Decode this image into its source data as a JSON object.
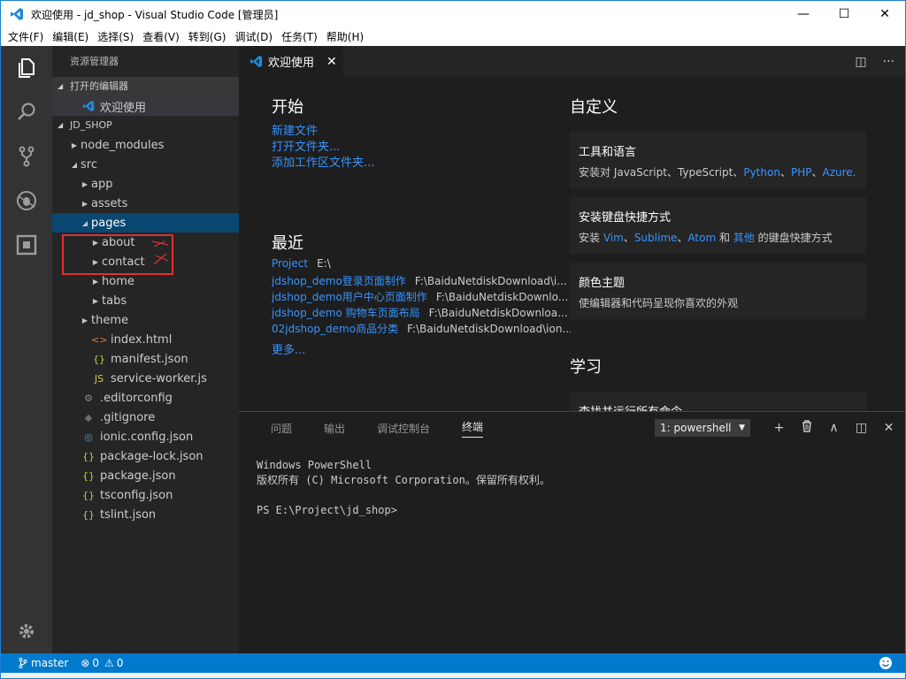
{
  "window": {
    "title": "欢迎使用 - jd_shop - Visual Studio Code [管理员]",
    "controls": {
      "minimize": "—",
      "maximize": "☐",
      "close": "✕"
    }
  },
  "menu": [
    "文件(F)",
    "编辑(E)",
    "选择(S)",
    "查看(V)",
    "转到(G)",
    "调试(D)",
    "任务(T)",
    "帮助(H)"
  ],
  "activity": [
    "explorer-icon",
    "search-icon",
    "source-control-icon",
    "debug-icon",
    "extensions-icon",
    "gear-icon"
  ],
  "sidebar": {
    "title": "资源管理器",
    "open_editors_header": "打开的编辑器",
    "open_editor": "欢迎使用",
    "project_header": "JD_SHOP",
    "tree": [
      {
        "label": "node_modules",
        "indent": 1,
        "twisty": "▶",
        "icon": ""
      },
      {
        "label": "src",
        "indent": 1,
        "twisty": "◢",
        "icon": ""
      },
      {
        "label": "app",
        "indent": 2,
        "twisty": "▶",
        "icon": ""
      },
      {
        "label": "assets",
        "indent": 2,
        "twisty": "▶",
        "icon": ""
      },
      {
        "label": "pages",
        "indent": 2,
        "twisty": "◢",
        "icon": "",
        "selected": true
      },
      {
        "label": "about",
        "indent": 3,
        "twisty": "▶",
        "icon": ""
      },
      {
        "label": "contact",
        "indent": 3,
        "twisty": "▶",
        "icon": ""
      },
      {
        "label": "home",
        "indent": 3,
        "twisty": "▶",
        "icon": ""
      },
      {
        "label": "tabs",
        "indent": 3,
        "twisty": "▶",
        "icon": ""
      },
      {
        "label": "theme",
        "indent": 2,
        "twisty": "▶",
        "icon": ""
      },
      {
        "label": "index.html",
        "indent": 2,
        "twisty": "",
        "icon": "<>",
        "iconColor": "#e37933"
      },
      {
        "label": "manifest.json",
        "indent": 2,
        "twisty": "",
        "icon": "{}",
        "iconColor": "#cbcb41"
      },
      {
        "label": "service-worker.js",
        "indent": 2,
        "twisty": "",
        "icon": "JS",
        "iconColor": "#cbcb41"
      },
      {
        "label": ".editorconfig",
        "indent": 1,
        "twisty": "",
        "icon": "⚙",
        "iconColor": "#8a8a8a"
      },
      {
        "label": ".gitignore",
        "indent": 1,
        "twisty": "",
        "icon": "◆",
        "iconColor": "#6d6d6d"
      },
      {
        "label": "ionic.config.json",
        "indent": 1,
        "twisty": "",
        "icon": "◎",
        "iconColor": "#519aba"
      },
      {
        "label": "package-lock.json",
        "indent": 1,
        "twisty": "",
        "icon": "{}",
        "iconColor": "#cbcb41"
      },
      {
        "label": "package.json",
        "indent": 1,
        "twisty": "",
        "icon": "{}",
        "iconColor": "#cbcb41"
      },
      {
        "label": "tsconfig.json",
        "indent": 1,
        "twisty": "",
        "icon": "{}",
        "iconColor": "#cbcb41"
      },
      {
        "label": "tslint.json",
        "indent": 1,
        "twisty": "",
        "icon": "{}",
        "iconColor": "#cbcb41"
      }
    ]
  },
  "editor": {
    "tab_label": "欢迎使用",
    "tab_close": "✕",
    "actions": [
      "◫",
      "···"
    ]
  },
  "welcome": {
    "start_heading": "开始",
    "start_links": [
      "新建文件",
      "打开文件夹...",
      "添加工作区文件夹..."
    ],
    "recent_heading": "最近",
    "recent": [
      {
        "name": "Project",
        "path": "E:\\"
      },
      {
        "name": "jdshop_demo登录页面制作",
        "path": "F:\\BaiduNetdiskDownload\\i..."
      },
      {
        "name": "jdshop_demo用户中心页面制作",
        "path": "F:\\BaiduNetdiskDownlo..."
      },
      {
        "name": "jdshop_demo 购物车页面布局",
        "path": "F:\\BaiduNetdiskDownloa..."
      },
      {
        "name": "02jdshop_demo商品分类",
        "path": "F:\\BaiduNetdiskDownload\\ion..."
      }
    ],
    "more_link": "更多...",
    "customize_heading": "自定义",
    "cards": [
      {
        "title": "工具和语言",
        "desc_prefix": "安装对 JavaScript、TypeScript、",
        "desc_links": [
          "Python",
          "PHP",
          "Azure.."
        ]
      },
      {
        "title": "安装键盘快捷方式",
        "desc_prefix": "安装 ",
        "desc_links": [
          "Vim",
          "Sublime",
          "Atom"
        ],
        "desc_mid": " 和 ",
        "desc_link_last": "其他",
        "desc_suffix": " 的键盘快捷方式"
      },
      {
        "title": "颜色主题",
        "desc": "使编辑器和代码呈现你喜欢的外观"
      }
    ],
    "learn_heading": "学习",
    "learn_card_title": "查找并运行所有命令"
  },
  "panel": {
    "tabs": [
      "问题",
      "输出",
      "调试控制台",
      "终端"
    ],
    "active_tab": "终端",
    "terminal_select": "1: powershell",
    "actions": [
      "+",
      "🗑",
      "∧",
      "◫",
      "✕"
    ],
    "terminal_lines": [
      "Windows PowerShell",
      "版权所有 (C) Microsoft Corporation。保留所有权利。",
      "",
      "PS E:\\Project\\jd_shop>"
    ]
  },
  "status": {
    "branch": "master",
    "errors": "0",
    "warnings": "0"
  },
  "colors": {
    "accent": "#007acc",
    "link": "#3794ff",
    "annotation": "#e03131"
  }
}
